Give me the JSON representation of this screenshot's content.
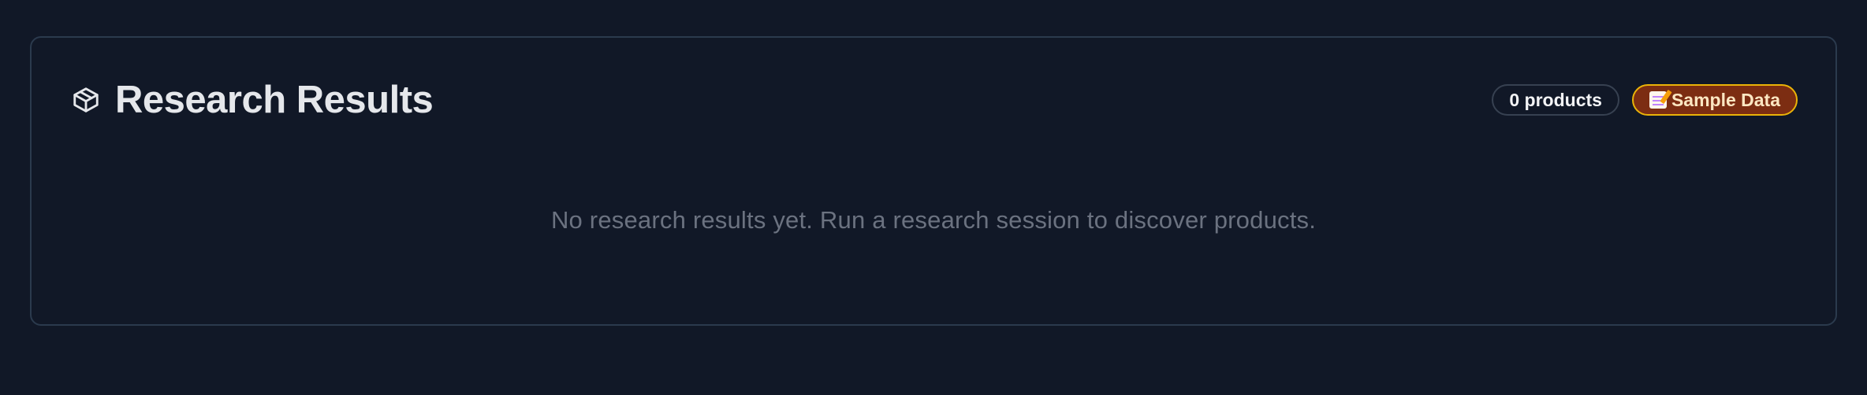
{
  "panel": {
    "title": "Research Results",
    "icon": "package-icon",
    "badges": {
      "count_label": "0 products",
      "sample_label": "Sample Data",
      "sample_icon": "memo-icon"
    },
    "empty_message": "No research results yet. Run a research session to discover products."
  },
  "colors": {
    "background": "#111827",
    "card_border": "#2b3a4d",
    "title_text": "#e5e7eb",
    "muted_text": "#6b7280",
    "sample_badge_bg": "#7c2d12",
    "sample_badge_border": "#eab308"
  }
}
